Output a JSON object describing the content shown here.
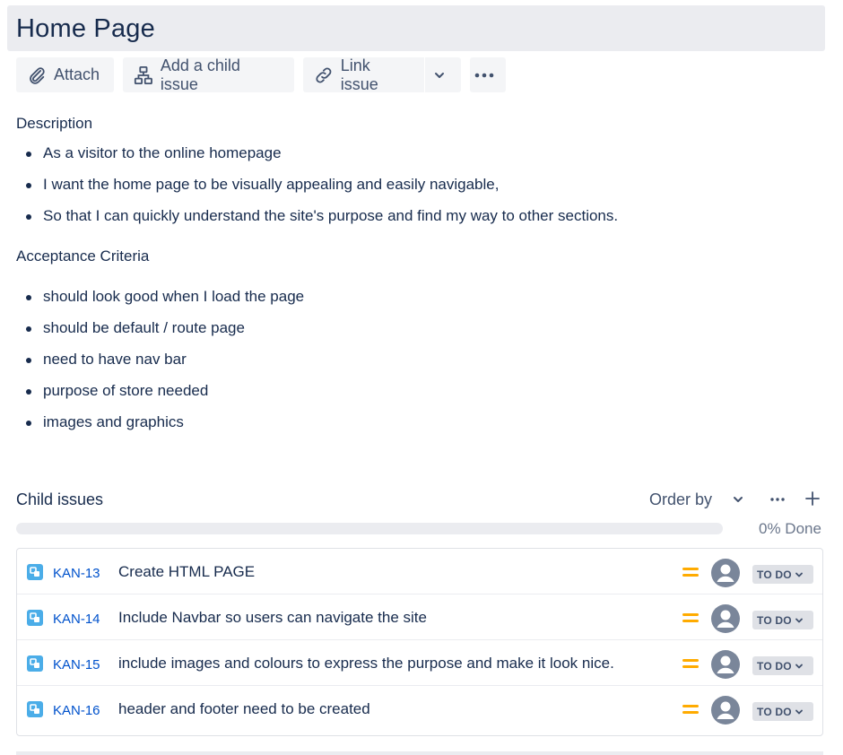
{
  "page": {
    "title": "Home Page"
  },
  "toolbar": {
    "attach_label": "Attach",
    "add_child_label": "Add a child issue",
    "link_label": "Link issue"
  },
  "description": {
    "label": "Description",
    "items": [
      "As a visitor to the online homepage",
      "I want the home page to be visually appealing and easily navigable,",
      "So that I can quickly understand the site's purpose and find my way to other sections."
    ]
  },
  "acceptance": {
    "label": "Acceptance Criteria",
    "items": [
      "should look good when I load the page",
      "should be default / route page",
      "need to have nav bar",
      "purpose of store needed",
      "images and graphics"
    ]
  },
  "child_issues": {
    "label": "Child issues",
    "order_by_label": "Order by",
    "progress_fraction": 0,
    "progress_label": "0% Done",
    "issues": [
      {
        "key": "KAN-13",
        "summary": "Create HTML PAGE",
        "status": "TO DO",
        "priority": "medium"
      },
      {
        "key": "KAN-14",
        "summary": "Include Navbar so users can navigate the site",
        "status": "TO DO",
        "priority": "medium"
      },
      {
        "key": "KAN-15",
        "summary": "include images and colours to express the purpose and make it look nice.",
        "status": "TO DO",
        "priority": "medium"
      },
      {
        "key": "KAN-16",
        "summary": "header and footer need to be created",
        "status": "TO DO",
        "priority": "medium"
      }
    ]
  },
  "colors": {
    "link": "#0052cc",
    "text": "#172b4d",
    "priority_medium": "#ffab00",
    "subtask_icon": "#4bade8",
    "status_bg": "#dfe1e6"
  },
  "icons": {
    "attach": "paperclip-icon",
    "add_child": "hierarchy-icon",
    "link": "link-icon",
    "dropdown": "chevron-down-icon",
    "more": "more-icon",
    "add": "plus-icon",
    "issue_type": "subtask-icon",
    "priority": "priority-medium-icon",
    "assignee": "avatar-icon"
  }
}
